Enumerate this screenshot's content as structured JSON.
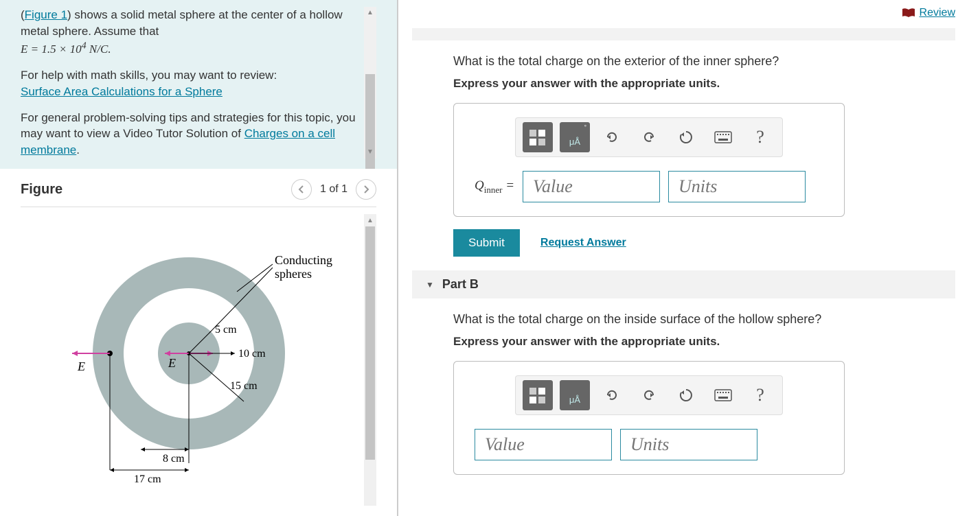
{
  "review_label": "Review",
  "problem": {
    "line1a": "(",
    "figure_link": "Figure 1",
    "line1b": ") shows a solid metal sphere at the center of a hollow metal sphere. Assume that",
    "formula_html": "E = 1.5 × 10⁴ N/C.",
    "help_intro": "For help with math skills, you may want to review:",
    "help_link": "Surface Area Calculations for a Sphere",
    "tips_intro": "For general problem-solving tips and strategies for this topic, you may want to view a Video Tutor Solution of ",
    "tips_link": "Charges on a cell membrane",
    "tips_period": "."
  },
  "figure": {
    "title": "Figure",
    "counter": "1 of 1",
    "labels": {
      "conducting": "Conducting\nspheres",
      "r5": "5 cm",
      "r10": "10 cm",
      "r15": "15 cm",
      "r8": "8 cm",
      "r17": "17 cm",
      "E": "E⃗"
    }
  },
  "partA": {
    "question": "What is the total charge on the exterior of the inner sphere?",
    "instruction": "Express your answer with the appropriate units.",
    "var_label": "Qinner =",
    "value_placeholder": "Value",
    "units_placeholder": "Units",
    "submit": "Submit",
    "request": "Request Answer"
  },
  "partB": {
    "header": "Part B",
    "question": "What is the total charge on the inside surface of the hollow sphere?",
    "instruction": "Express your answer with the appropriate units.",
    "value_placeholder": "Value",
    "units_placeholder": "Units"
  },
  "toolbar": {
    "help": "?"
  }
}
